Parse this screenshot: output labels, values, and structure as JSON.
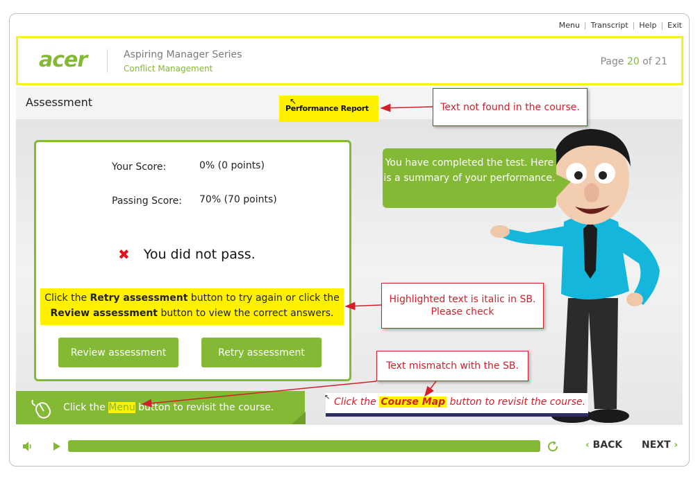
{
  "topnav": {
    "menu": "Menu",
    "transcript": "Transcript",
    "help": "Help",
    "exit": "Exit"
  },
  "header": {
    "logo": "acer",
    "series": "Aspiring Manager Series",
    "course": "Conflict Management",
    "page_prefix": "Page",
    "page_current": "20",
    "page_of": "of",
    "page_total": "21"
  },
  "assessment": {
    "title": "Assessment",
    "your_score_label": "Your Score:",
    "your_score_value": "0% (0 points)",
    "passing_score_label": "Passing Score:",
    "passing_score_value": "70% (70 points)",
    "result": "You did not pass.",
    "instruction": {
      "part1": "Click the ",
      "retry_bold": "Retry assessment",
      "part2": " button to try again or click the ",
      "review_bold": "Review assessment",
      "part3": " button to view the correct answers."
    },
    "review_button": "Review assessment",
    "retry_button": "Retry assessment"
  },
  "bubble": {
    "text": "You have completed the test. Here is a summary of your performance."
  },
  "footer_hint": {
    "prefix": "Click the ",
    "menu": "Menu",
    "suffix": " button to revisit the course."
  },
  "sb_strip": {
    "prefix": "Click the ",
    "course_map": "Course Map",
    "suffix": " button to revisit the course."
  },
  "performance_report": "Performance Report",
  "review_notes": {
    "note1": "Text not found in the course.",
    "note2_line1": "Highlighted text is italic in SB.",
    "note2_line2": "Please check",
    "note3": "Text mismatch with the SB."
  },
  "controls": {
    "back": "BACK",
    "next": "NEXT"
  },
  "colors": {
    "accent": "#83b935",
    "highlight": "#fff100",
    "annotation": "#d0202c",
    "header_border": "#f5f023"
  },
  "icons": [
    "volume-icon",
    "play-icon",
    "replay-icon",
    "mouse-icon",
    "close-x-icon",
    "chevron-left-icon",
    "chevron-right-icon"
  ]
}
